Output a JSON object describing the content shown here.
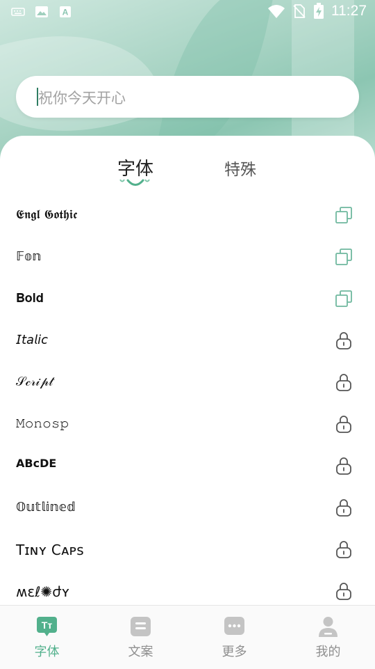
{
  "status_bar": {
    "time": "11:27",
    "left_icons": [
      "keyboard-icon",
      "image-icon",
      "font-a-icon"
    ],
    "right_icons": [
      "wifi-icon",
      "no-sim-icon",
      "battery-charging-icon"
    ]
  },
  "search": {
    "placeholder": "祝你今天开心"
  },
  "tabs": [
    {
      "label": "字体",
      "active": true
    },
    {
      "label": "特殊",
      "active": false
    }
  ],
  "font_list": [
    {
      "label": "𝕰𝖓𝖌𝖑 𝕲𝖔𝖙𝖍𝖎𝖈",
      "action": "copy"
    },
    {
      "label": "𝔽𝕠𝕟",
      "action": "copy"
    },
    {
      "label": "𝐁𝐨𝐥𝐝",
      "action": "copy"
    },
    {
      "label": "𝘐𝘵𝘢𝘭𝘪𝘤",
      "action": "locked"
    },
    {
      "label": "𝒮𝒸𝓇𝒾𝓅𝓉",
      "action": "locked"
    },
    {
      "label": "𝙼𝚘𝚗𝚘𝚜𝚙",
      "action": "locked"
    },
    {
      "label": "ABcDE",
      "action": "locked"
    },
    {
      "label": "𝕆𝕦𝕥𝕝𝕚𝕟𝕖𝕕",
      "action": "locked"
    },
    {
      "label": "Tɪɴʏ Cᴀᴘs",
      "action": "locked"
    },
    {
      "label": "ʍɛℓ✺ժʏ",
      "action": "locked"
    }
  ],
  "bottom_nav": [
    {
      "label": "字体",
      "icon": "font-tt-icon",
      "active": true
    },
    {
      "label": "文案",
      "icon": "copywriting-icon",
      "active": false
    },
    {
      "label": "更多",
      "icon": "more-chat-icon",
      "active": false
    },
    {
      "label": "我的",
      "icon": "profile-icon",
      "active": false
    }
  ],
  "colors": {
    "accent": "#52b08c",
    "accent_dark": "#2f7d63",
    "inactive": "#bdbdbd"
  }
}
